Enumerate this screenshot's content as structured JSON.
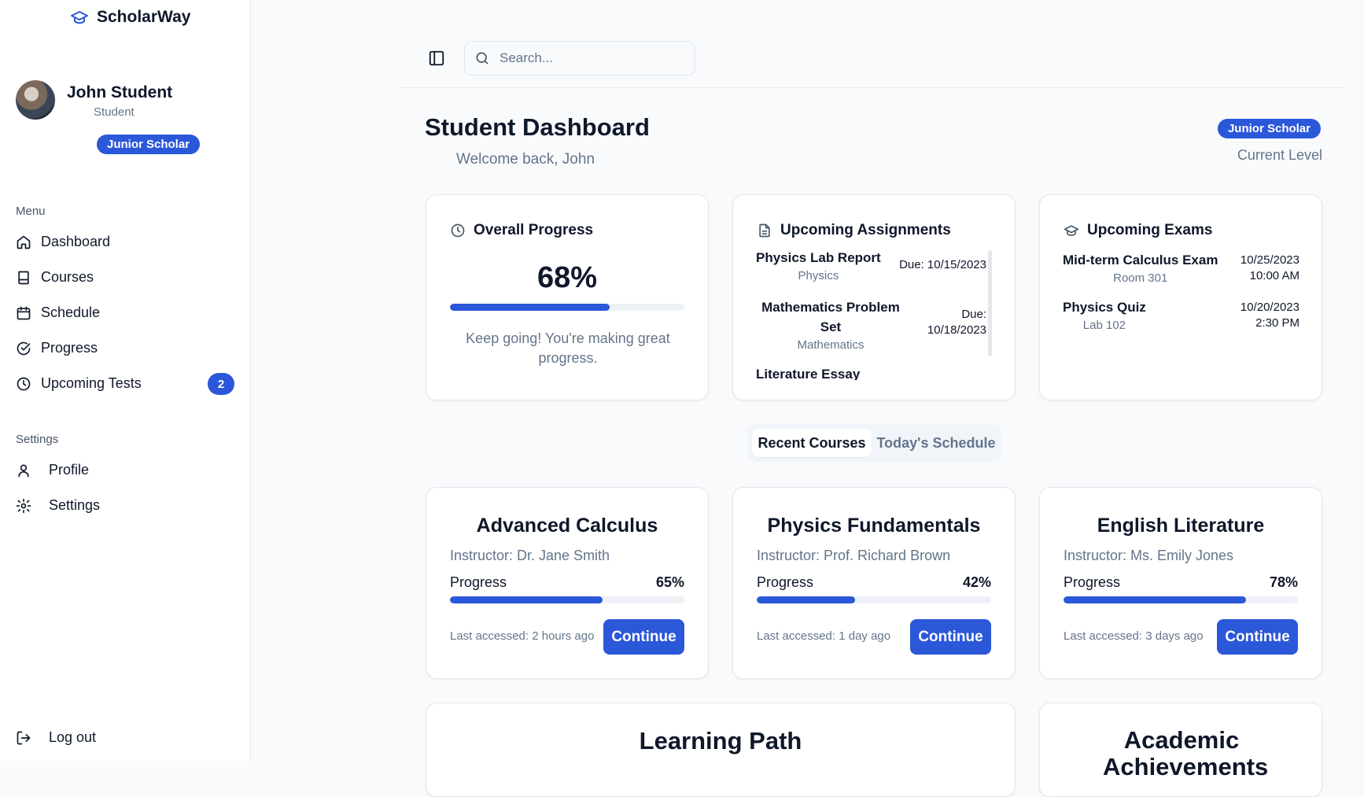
{
  "app": {
    "name": "ScholarWay"
  },
  "user": {
    "name": "John Student",
    "role": "Student",
    "level": "Junior Scholar"
  },
  "sidebar": {
    "menu_label": "Menu",
    "items": [
      {
        "label": "Dashboard",
        "icon": "home-icon"
      },
      {
        "label": "Courses",
        "icon": "book-icon"
      },
      {
        "label": "Schedule",
        "icon": "calendar-icon"
      },
      {
        "label": "Progress",
        "icon": "check-circle-icon"
      },
      {
        "label": "Upcoming Tests",
        "icon": "clock-icon",
        "badge": "2"
      }
    ],
    "settings_label": "Settings",
    "settings_items": [
      {
        "label": "Profile",
        "icon": "user-icon"
      },
      {
        "label": "Settings",
        "icon": "gear-icon"
      }
    ],
    "logout_label": "Log out"
  },
  "search": {
    "placeholder": "Search..."
  },
  "header": {
    "title": "Student Dashboard",
    "welcome": "Welcome back, John",
    "level_badge": "Junior Scholar",
    "level_label": "Current Level"
  },
  "overall_progress": {
    "title": "Overall Progress",
    "percent_text": "68%",
    "percent": 68,
    "message": "Keep going! You're making great progress."
  },
  "assignments": {
    "title": "Upcoming Assignments",
    "items": [
      {
        "title": "Physics Lab Report",
        "subject": "Physics",
        "due": "Due: 10/15/2023"
      },
      {
        "title": "Mathematics Problem Set",
        "subject": "Mathematics",
        "due": "Due: 10/18/2023"
      },
      {
        "title": "Literature Essay",
        "subject": "",
        "due": ""
      }
    ]
  },
  "exams": {
    "title": "Upcoming Exams",
    "items": [
      {
        "title": "Mid-term Calculus Exam",
        "room": "Room 301",
        "date": "10/25/2023",
        "time": "10:00 AM"
      },
      {
        "title": "Physics Quiz",
        "room": "Lab 102",
        "date": "10/20/2023",
        "time": "2:30 PM"
      }
    ]
  },
  "tabs": [
    {
      "label": "Recent Courses",
      "active": true
    },
    {
      "label": "Today's Schedule",
      "active": false
    }
  ],
  "courses": [
    {
      "title": "Advanced Calculus",
      "instructor": "Instructor: Dr. Jane Smith",
      "progress_label": "Progress",
      "progress_text": "65%",
      "progress": 65,
      "last_accessed": "Last accessed: 2 hours ago",
      "button": "Continue"
    },
    {
      "title": "Physics Fundamentals",
      "instructor": "Instructor: Prof. Richard Brown",
      "progress_label": "Progress",
      "progress_text": "42%",
      "progress": 42,
      "last_accessed": "Last accessed: 1 day ago",
      "button": "Continue"
    },
    {
      "title": "English Literature",
      "instructor": "Instructor: Ms. Emily Jones",
      "progress_label": "Progress",
      "progress_text": "78%",
      "progress": 78,
      "last_accessed": "Last accessed: 3 days ago",
      "button": "Continue"
    }
  ],
  "bottom_cards": [
    {
      "title": "Learning Path"
    },
    {
      "title": "Academic Achievements"
    }
  ],
  "colors": {
    "accent": "#2b57d9",
    "muted_text": "#64748b",
    "background": "#f8fafc"
  }
}
